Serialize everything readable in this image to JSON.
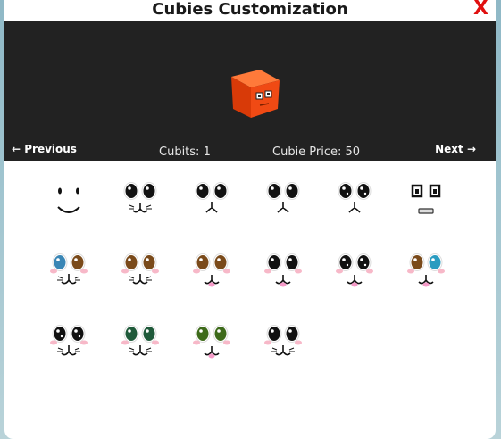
{
  "window": {
    "title": "Cubies Customization",
    "close_label": "X"
  },
  "preview": {
    "cube_color": "#f04a14",
    "previous_label": "← Previous",
    "next_label": "Next →",
    "cubits_text": "Cubits: 1",
    "price_text": "Cubie Price: 50"
  },
  "faces": [
    {
      "name": "face-smile",
      "eyes": "dot",
      "eye_color": "#111111",
      "mouth": "smile",
      "blush": false
    },
    {
      "name": "face-whisker-big-eyes",
      "eyes": "big",
      "eye_color": "#111111",
      "mouth": "cat",
      "blush": false
    },
    {
      "name": "face-cat-big-eyes",
      "eyes": "big",
      "eye_color": "#111111",
      "mouth": "cat-small",
      "blush": false
    },
    {
      "name": "face-cat-big-eyes-2",
      "eyes": "big",
      "eye_color": "#111111",
      "mouth": "cat-small",
      "blush": false
    },
    {
      "name": "face-cat-sparkle-eyes",
      "eyes": "sparkle",
      "eye_color": "#111111",
      "mouth": "cat-small",
      "blush": false
    },
    {
      "name": "face-robot",
      "eyes": "square",
      "eye_color": "#111111",
      "mouth": "grille",
      "blush": false
    },
    {
      "name": "face-blue-brown-eyes",
      "eyes": "heterochromia",
      "eye_color": "#3a86b5",
      "eye_color_2": "#7a4a1a",
      "mouth": "cat",
      "blush": true
    },
    {
      "name": "face-brown-eyes",
      "eyes": "big",
      "eye_color": "#7a4a1a",
      "mouth": "cat",
      "blush": true
    },
    {
      "name": "face-brown-eyes-tongue",
      "eyes": "big",
      "eye_color": "#7a4a1a",
      "mouth": "cat-tongue",
      "blush": true
    },
    {
      "name": "face-black-eyes-tongue",
      "eyes": "big",
      "eye_color": "#111111",
      "mouth": "cat-tongue",
      "blush": true
    },
    {
      "name": "face-sparkle-tongue",
      "eyes": "sparkle",
      "eye_color": "#111111",
      "mouth": "cat-tongue",
      "blush": true
    },
    {
      "name": "face-brown-blue-eyes",
      "eyes": "heterochromia",
      "eye_color": "#7a4a1a",
      "eye_color_2": "#2a9bc0",
      "mouth": "cat-tongue",
      "blush": true
    },
    {
      "name": "face-sparkle-whisker",
      "eyes": "sparkle",
      "eye_color": "#111111",
      "mouth": "cat",
      "blush": true
    },
    {
      "name": "face-green-eyes",
      "eyes": "big",
      "eye_color": "#1f5a3a",
      "mouth": "cat",
      "blush": true
    },
    {
      "name": "face-olive-eyes-tongue",
      "eyes": "big",
      "eye_color": "#3d6a1a",
      "mouth": "cat-tongue",
      "blush": true
    },
    {
      "name": "face-black-eyes-whisker",
      "eyes": "big",
      "eye_color": "#111111",
      "mouth": "cat",
      "blush": true
    }
  ]
}
